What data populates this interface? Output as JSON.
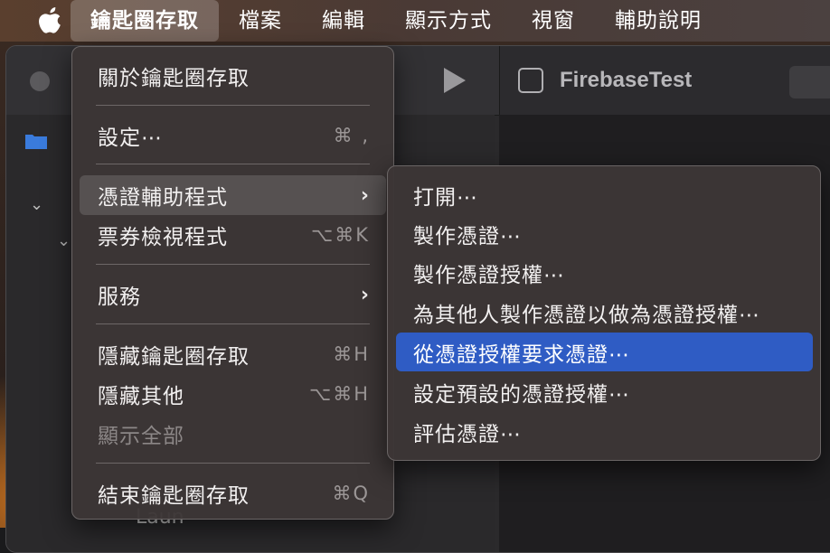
{
  "menubar": {
    "items": [
      {
        "label": "鑰匙圈存取"
      },
      {
        "label": "檔案"
      },
      {
        "label": "編輯"
      },
      {
        "label": "顯示方式"
      },
      {
        "label": "視窗"
      },
      {
        "label": "輔助說明"
      }
    ]
  },
  "window": {
    "tab_title": "FirebaseTest",
    "peek_text": "Laun"
  },
  "menu": {
    "items": [
      {
        "label": "關於鑰匙圈存取",
        "shortcut": ""
      },
      {
        "label": "設定⋯",
        "shortcut": "⌘ ,"
      },
      {
        "label": "憑證輔助程式",
        "shortcut": "›"
      },
      {
        "label": "票券檢視程式",
        "shortcut": "⌥⌘K"
      },
      {
        "label": "服務",
        "shortcut": "›"
      },
      {
        "label": "隱藏鑰匙圈存取",
        "shortcut": "⌘H"
      },
      {
        "label": "隱藏其他",
        "shortcut": "⌥⌘H"
      },
      {
        "label": "顯示全部",
        "shortcut": ""
      },
      {
        "label": "結束鑰匙圈存取",
        "shortcut": "⌘Q"
      }
    ]
  },
  "submenu": {
    "items": [
      {
        "label": "打開⋯"
      },
      {
        "label": "製作憑證⋯"
      },
      {
        "label": "製作憑證授權⋯"
      },
      {
        "label": "為其他人製作憑證以做為憑證授權⋯"
      },
      {
        "label": "從憑證授權要求憑證⋯"
      },
      {
        "label": "設定預設的憑證授權⋯"
      },
      {
        "label": "評估憑證⋯"
      }
    ]
  },
  "colors": {
    "selection": "#2f5cc4",
    "menu_bg": "#3c3636"
  }
}
